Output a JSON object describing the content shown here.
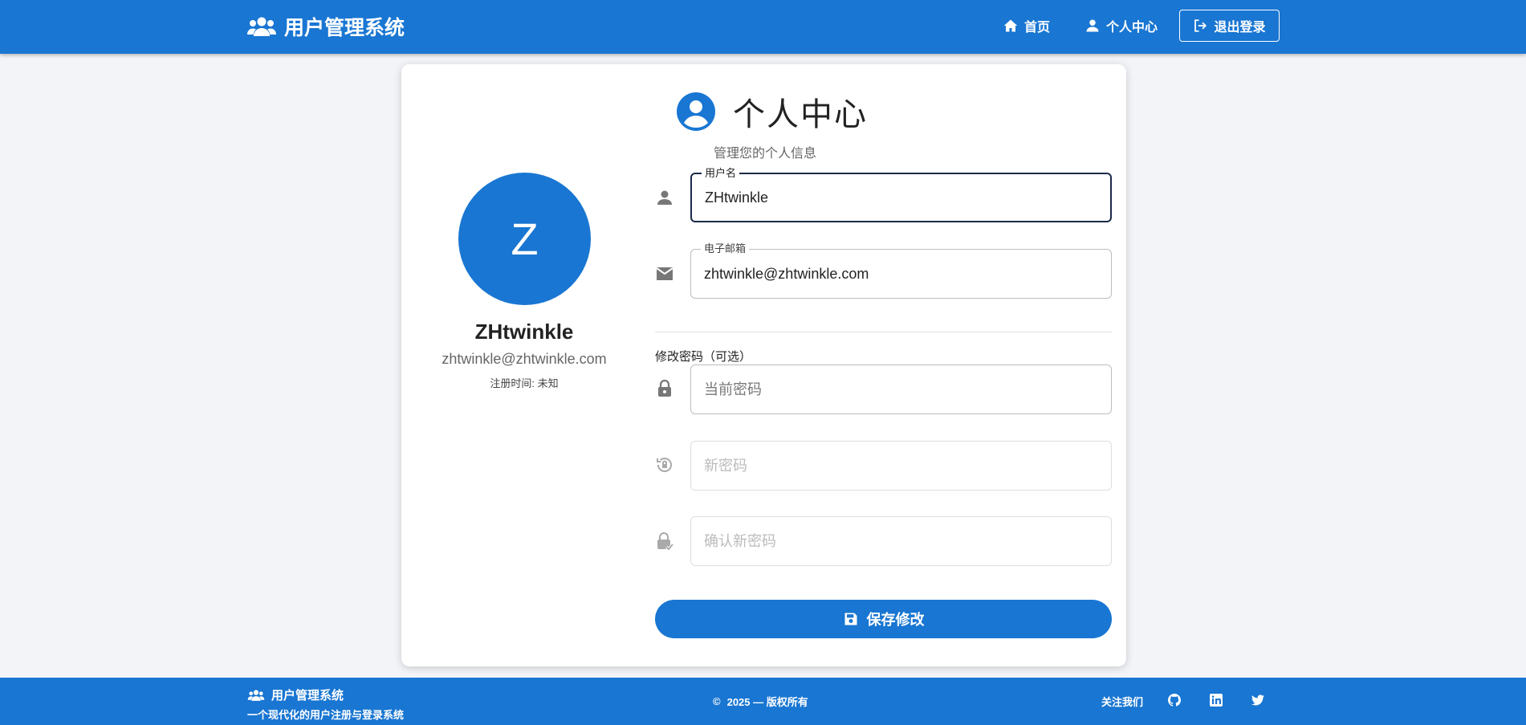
{
  "header": {
    "brand": "用户管理系统",
    "nav": {
      "home": "首页",
      "profile": "个人中心",
      "logout": "退出登录"
    }
  },
  "page": {
    "title": "个人中心",
    "subtitle": "管理您的个人信息"
  },
  "profile": {
    "avatar_letter": "Z",
    "name": "ZHtwinkle",
    "email": "zhtwinkle@zhtwinkle.com",
    "registered": "注册时间: 未知"
  },
  "form": {
    "username": {
      "label": "用户名",
      "value": "ZHtwinkle"
    },
    "email": {
      "label": "电子邮箱",
      "value": "zhtwinkle@zhtwinkle.com"
    },
    "password_section": "修改密码（可选）",
    "current_password": {
      "placeholder": "当前密码"
    },
    "new_password": {
      "placeholder": "新密码"
    },
    "confirm_password": {
      "placeholder": "确认新密码"
    },
    "save_label": "保存修改"
  },
  "footer": {
    "brand": "用户管理系统",
    "tagline": "一个现代化的用户注册与登录系统",
    "copyright": "2025 — 版权所有",
    "copyright_symbol": "©",
    "follow": "关注我们",
    "social": [
      "github-icon",
      "linkedin-icon",
      "twitter-icon"
    ]
  },
  "colors": {
    "primary": "#1976d2",
    "background": "#f2f4f8",
    "focus_border": "#1b2a4a"
  }
}
